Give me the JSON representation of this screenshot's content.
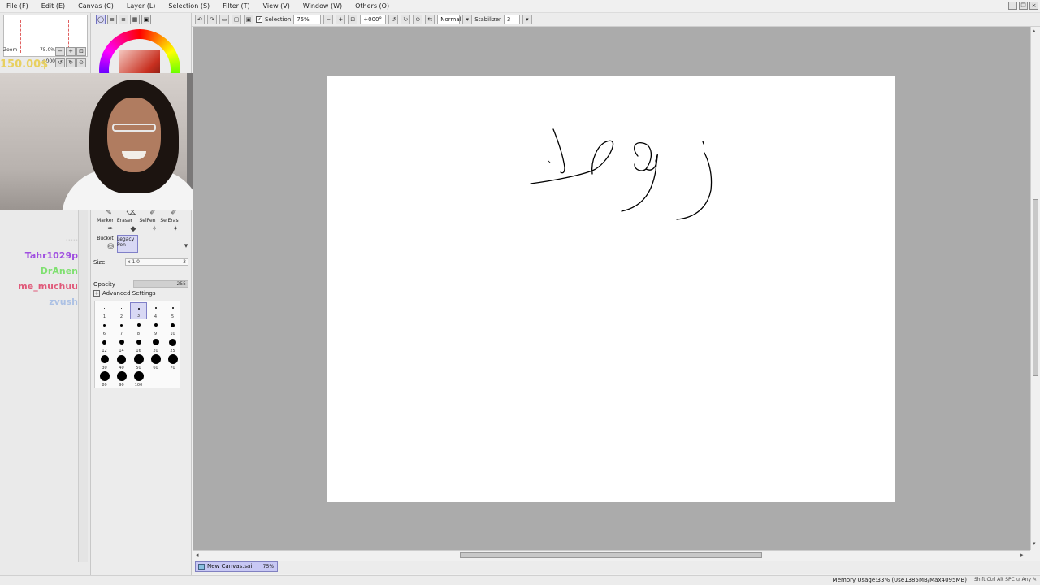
{
  "menu": [
    "File (F)",
    "Edit (E)",
    "Canvas (C)",
    "Layer (L)",
    "Selection (S)",
    "Filter (T)",
    "View (V)",
    "Window (W)",
    "Others (O)"
  ],
  "navigator": {
    "zoom_label": "Zoom",
    "zoom_value": "75.0%",
    "angle_value": "+000"
  },
  "donation_text": "150.00$",
  "chat": {
    "users": [
      "Tahr1029p",
      "DrAnen",
      "me_muchuu",
      "zvush"
    ],
    "colors": [
      "#a050e0",
      "#7fe070",
      "#e05a7a",
      "#7aa0e0"
    ]
  },
  "tools": {
    "row1": [
      "Marker",
      "Eraser",
      "SelPen",
      "SelEras"
    ],
    "row2": [
      "Bucket",
      "Legacy Pen"
    ],
    "size_label": "Size",
    "size_mult": "x 1.0",
    "size_value": "3",
    "opacity_label": "Opacity",
    "opacity_value": "255",
    "advanced_label": "Advanced Settings"
  },
  "brush_sizes": [
    "1",
    "2",
    "3",
    "4",
    "5",
    "6",
    "7",
    "8",
    "9",
    "10",
    "12",
    "14",
    "16",
    "20",
    "25",
    "30",
    "40",
    "50",
    "60",
    "70",
    "80",
    "90",
    "100"
  ],
  "toolbar": {
    "selection_label": "Selection",
    "zoom": "75%",
    "rotation": "+000°",
    "blend_mode": "Normal",
    "stabilizer_label": "Stabilizer",
    "stabilizer_value": "3"
  },
  "canvas_tab": {
    "name": "New Canvas.sai",
    "zoom": "75%"
  },
  "status": {
    "memory": "Memory Usage:33% (Use1385MB/Max4095MB)",
    "keys": "Shift Ctrl Alt SPC ⊙ Any ✎"
  }
}
